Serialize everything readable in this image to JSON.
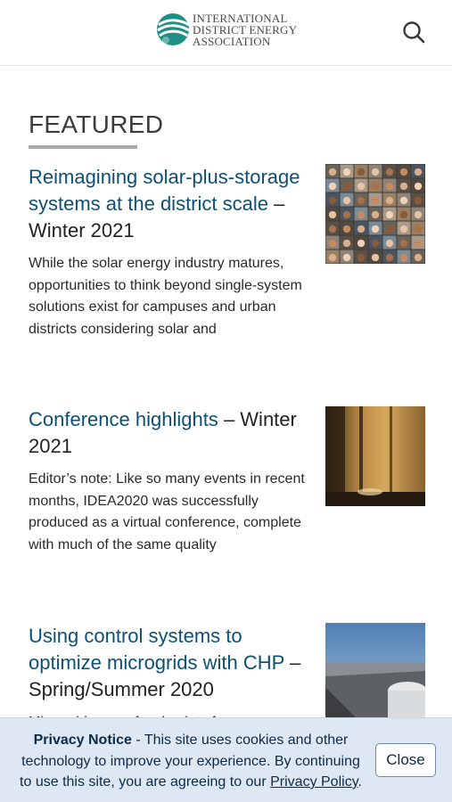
{
  "header": {
    "logo_lines": [
      "INTERNATIONAL",
      "DISTRICT ENERGY",
      "ASSOCIATION"
    ],
    "search_icon": "search-icon"
  },
  "section": {
    "title": "FEATURED"
  },
  "articles": [
    {
      "title": "Reimagining solar-plus-storage systems at the district scale",
      "issue": "– Winter 2021",
      "excerpt": "While the solar energy industry matures, opportunities to think beyond single-system solutions exist for campuses and urban districts considering solar and",
      "thumbnail": "video-conference-grid-image"
    },
    {
      "title": "Conference highlights",
      "issue": "– Winter 2021",
      "excerpt": "Editor’s note: Like so many events in recent months, IDEA2020 was successfully produced as a virtual conference, complete with much of the same quality",
      "thumbnail": "wood-panel-lobby-image"
    },
    {
      "title": "Using control systems to optimize microgrids with CHP",
      "issue": "– Spring/Summer 2020",
      "excerpt": "Microgrids are a focal point of",
      "thumbnail": "rooftop-building-image"
    }
  ],
  "privacy": {
    "heading": "Privacy Notice",
    "body": " - This site uses cookies and other technology to improve your experience. By continuing to use this site, you are agreeing to our ",
    "link": "Privacy Policy",
    "end": ".",
    "close_label": "Close"
  }
}
